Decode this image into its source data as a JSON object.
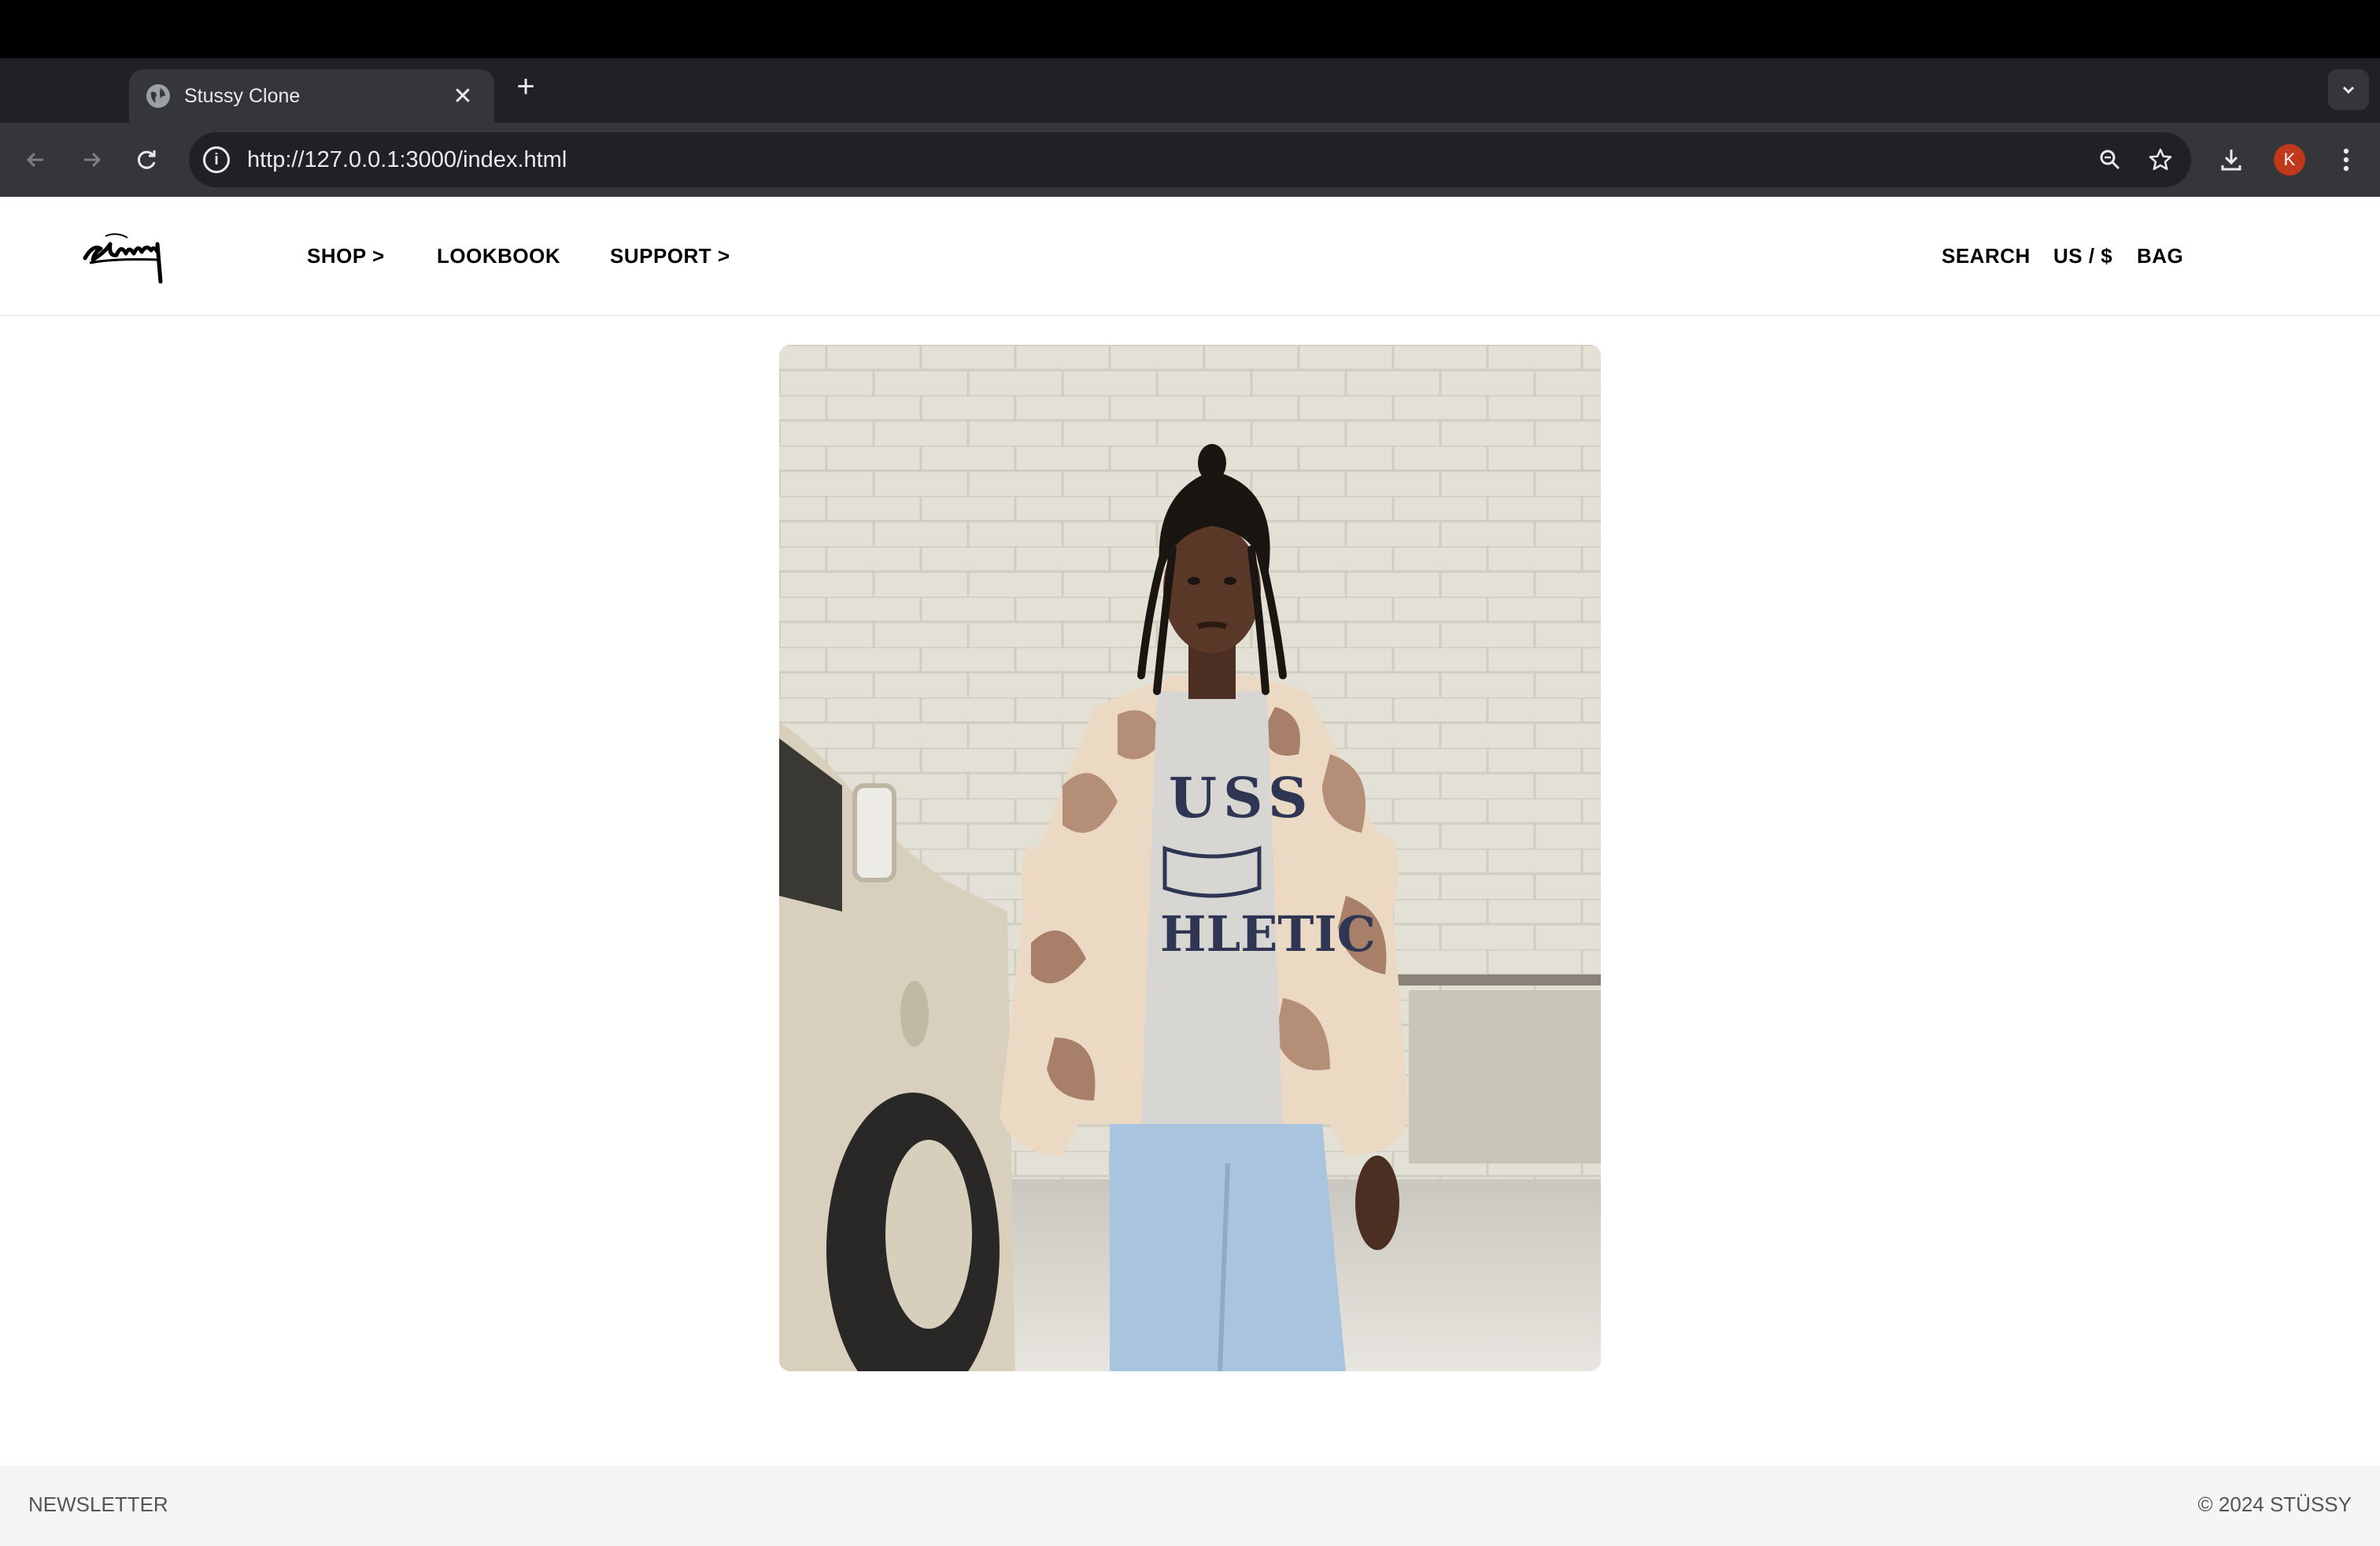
{
  "browser": {
    "tab_title": "Stussy Clone",
    "new_tab_symbol": "+",
    "close_symbol": "✕",
    "url": "http://127.0.0.1:3000/index.html",
    "profile_initial": "K",
    "profile_color": "#c0391b"
  },
  "site": {
    "logo_alt": "Stüssy logo",
    "nav_left": [
      "SHOP >",
      "LOOKBOOK",
      "SUPPORT >"
    ],
    "nav_right": [
      "SEARCH",
      "US / $",
      "BAG"
    ]
  },
  "hero": {
    "image_alt": "Model in desert camo puffer jacket standing beside a white vehicle",
    "shirt_print_top": "USS",
    "shirt_print_bottom": "HLETIC"
  },
  "footer": {
    "left": "NEWSLETTER",
    "right": "© 2024 STÜSSY"
  }
}
